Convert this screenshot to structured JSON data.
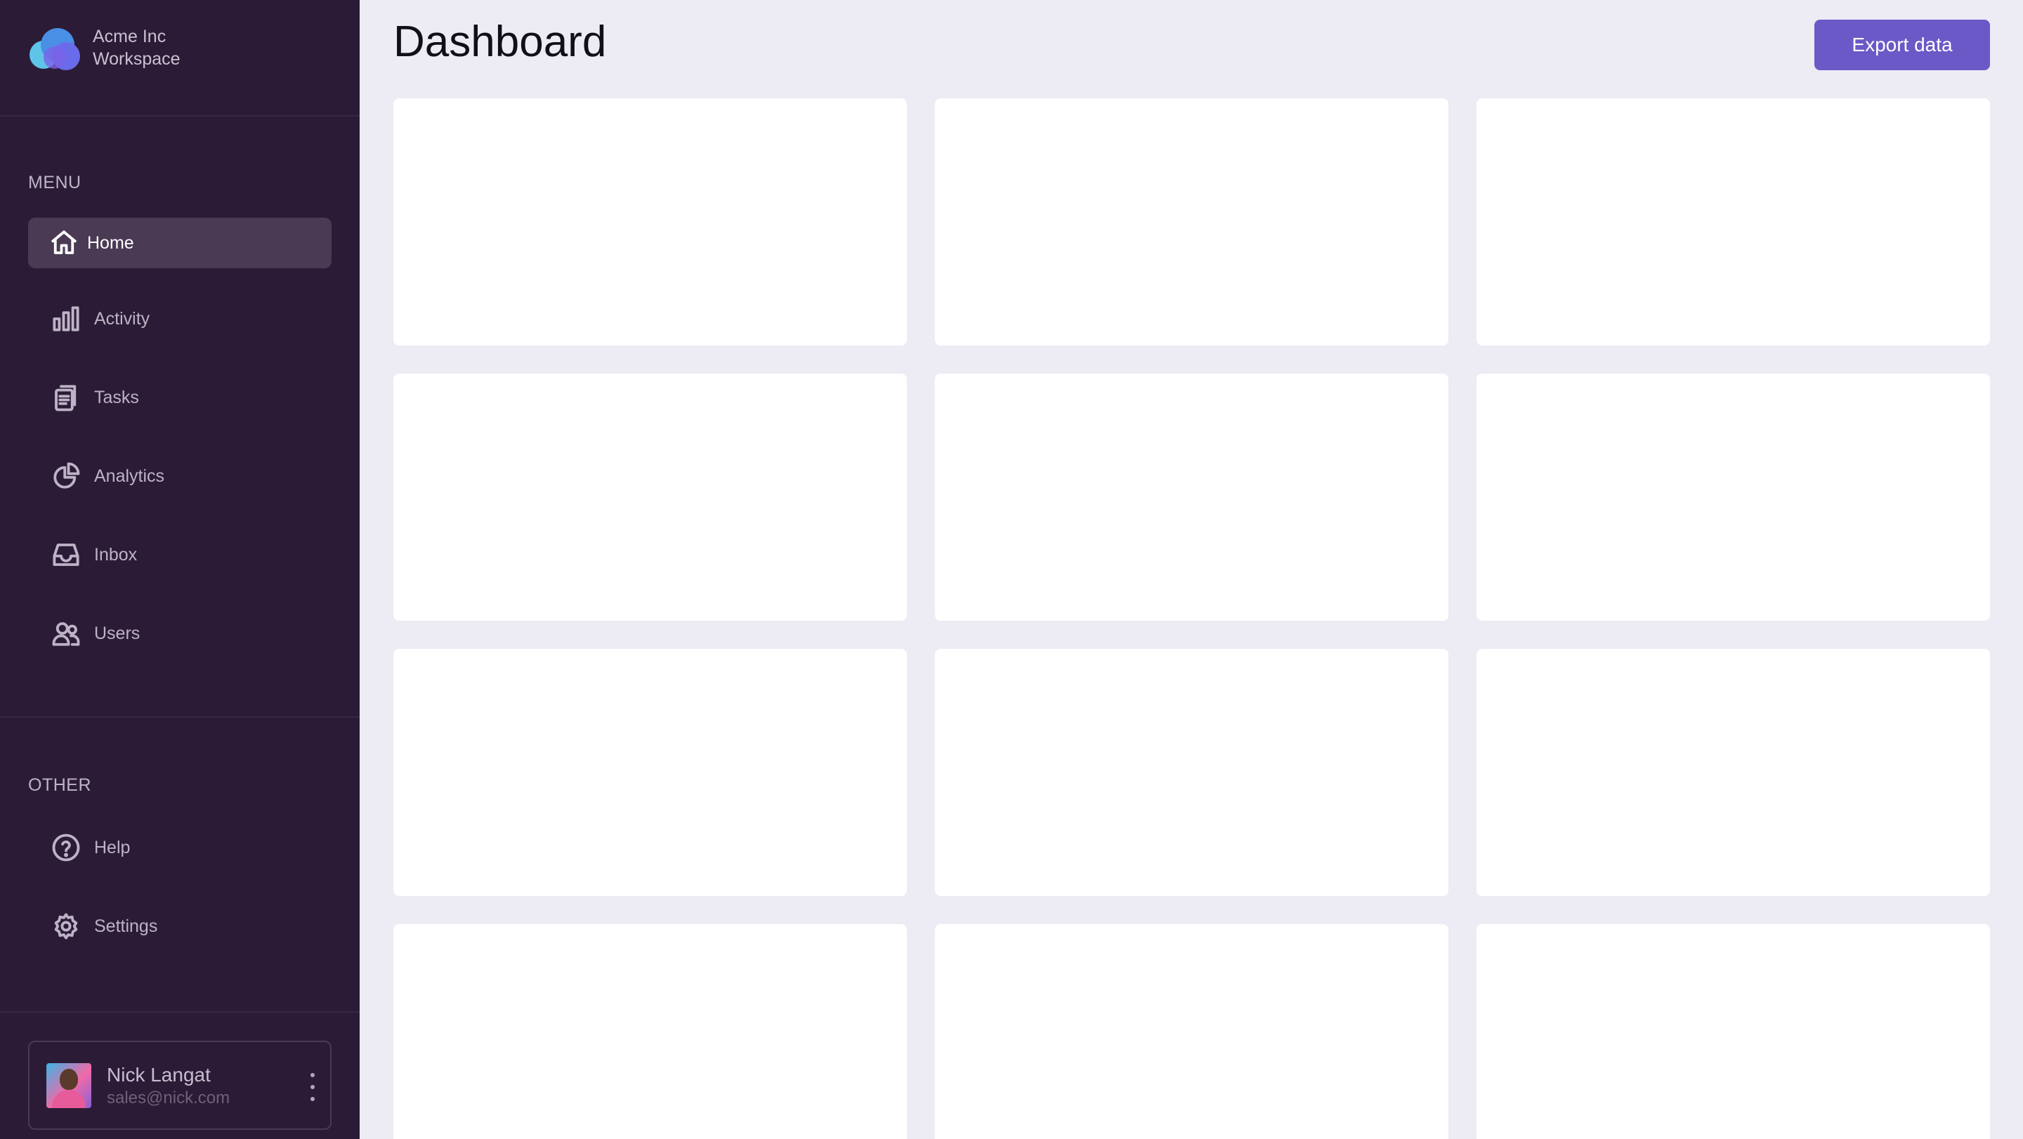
{
  "brand": {
    "name_line1": "Acme Inc",
    "name_line2": "Workspace"
  },
  "sidebar": {
    "menu_label": "MENU",
    "menu_items": [
      {
        "label": "Home",
        "icon": "home-icon",
        "active": true
      },
      {
        "label": "Activity",
        "icon": "bar-chart-icon",
        "active": false
      },
      {
        "label": "Tasks",
        "icon": "clipboard-icon",
        "active": false
      },
      {
        "label": "Analytics",
        "icon": "pie-chart-icon",
        "active": false
      },
      {
        "label": "Inbox",
        "icon": "inbox-icon",
        "active": false
      },
      {
        "label": "Users",
        "icon": "users-icon",
        "active": false
      }
    ],
    "other_label": "OTHER",
    "other_items": [
      {
        "label": "Help",
        "icon": "help-circle-icon"
      },
      {
        "label": "Settings",
        "icon": "gear-icon"
      }
    ]
  },
  "user": {
    "name": "Nick Langat",
    "email": "sales@nick.com"
  },
  "main": {
    "title": "Dashboard",
    "export_label": "Export data",
    "card_count": 12
  },
  "colors": {
    "sidebar_bg": "#2C1B36",
    "main_bg": "#EDEBF4",
    "accent": "#6A59C7",
    "active_item_bg": "#4A3A54"
  }
}
